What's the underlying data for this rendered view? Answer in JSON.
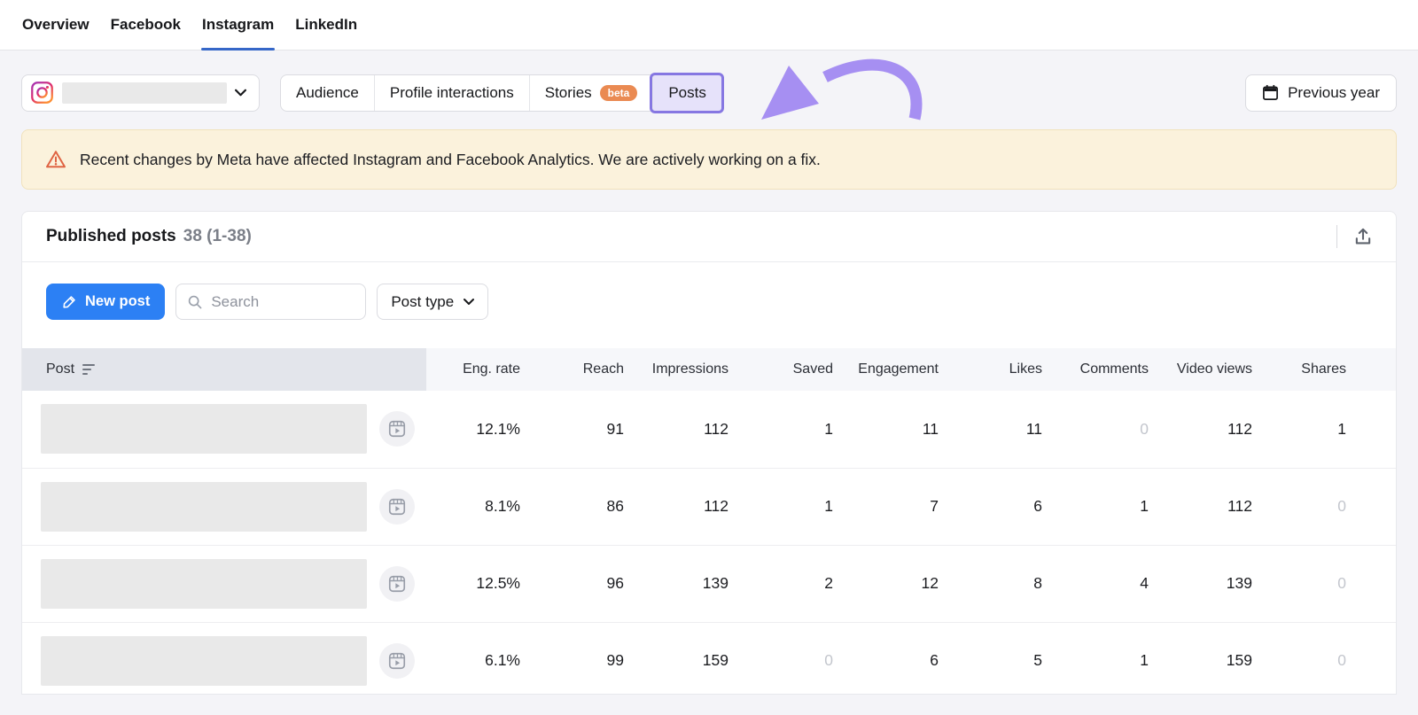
{
  "nav": {
    "tabs": [
      {
        "label": "Overview",
        "active": false
      },
      {
        "label": "Facebook",
        "active": false
      },
      {
        "label": "Instagram",
        "active": true
      },
      {
        "label": "LinkedIn",
        "active": false
      }
    ]
  },
  "controls": {
    "account_selector": {
      "icon": "instagram-icon",
      "value_redacted": true
    },
    "section_tabs": [
      {
        "label": "Audience"
      },
      {
        "label": "Profile interactions"
      },
      {
        "label": "Stories",
        "badge": "beta"
      },
      {
        "label": "Posts",
        "highlighted": true
      }
    ],
    "previous_year_label": "Previous year"
  },
  "banner": {
    "text": "Recent changes by Meta have affected Instagram and Facebook Analytics. We are actively working on a fix."
  },
  "posts": {
    "title": "Published posts",
    "count": "38 (1-38)",
    "toolbar": {
      "new_post_label": "New post",
      "search_placeholder": "Search",
      "post_type_label": "Post type"
    },
    "table": {
      "columns": [
        "Post",
        "Eng. rate",
        "Reach",
        "Impressions",
        "Saved",
        "Engagement",
        "Likes",
        "Comments",
        "Video views",
        "Shares"
      ],
      "rows": [
        [
          "12.1%",
          "91",
          "112",
          "1",
          "11",
          "11",
          "0",
          "112",
          "1"
        ],
        [
          "8.1%",
          "86",
          "112",
          "1",
          "7",
          "6",
          "1",
          "112",
          "0"
        ],
        [
          "12.5%",
          "96",
          "139",
          "2",
          "12",
          "8",
          "4",
          "139",
          "0"
        ],
        [
          "6.1%",
          "99",
          "159",
          "0",
          "6",
          "5",
          "1",
          "159",
          "0"
        ]
      ]
    }
  },
  "colors": {
    "accent_blue": "#2c80f4",
    "nav_active_underline": "#3567c8",
    "annotation_purple": "#a68ff2",
    "annotation_box_border": "#8677e2",
    "annotation_box_fill": "#e6e2fa",
    "beta_badge": "#ea8a52",
    "banner_bg": "#fbf2dc",
    "warning_icon": "#df6443",
    "muted_zero": "#c3c6cd"
  }
}
